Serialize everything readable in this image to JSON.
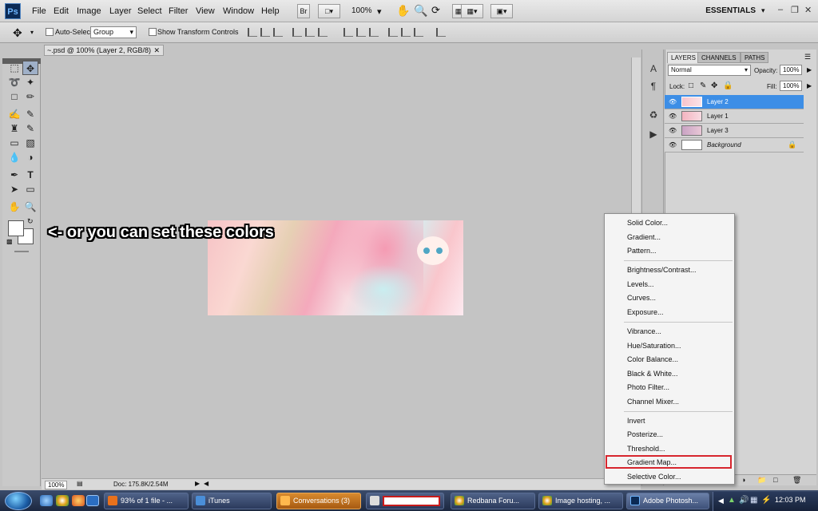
{
  "app": {
    "logo": "Ps",
    "menus": [
      "File",
      "Edit",
      "Image",
      "Layer",
      "Select",
      "Filter",
      "View",
      "Window",
      "Help"
    ],
    "bridge_btn": "Br",
    "zoom": "100%",
    "workspace": "ESSENTIALS"
  },
  "options": {
    "auto_select_label": "Auto-Select:",
    "auto_select_value": "Group",
    "transform_label": "Show Transform Controls"
  },
  "document": {
    "tab_title": "~.psd @ 100% (Layer 2, RGB/8)",
    "annotation": "<- or you can set these colors",
    "status_zoom": "100%",
    "status_doc": "Doc: 175.8K/2.54M"
  },
  "layers_panel": {
    "tabs": [
      "LAYERS",
      "CHANNELS",
      "PATHS"
    ],
    "blend_mode": "Normal",
    "opacity_label": "Opacity:",
    "opacity_value": "100%",
    "lock_label": "Lock:",
    "fill_label": "Fill:",
    "fill_value": "100%",
    "layers": [
      {
        "name": "Layer 2",
        "selected": true
      },
      {
        "name": "Layer 1",
        "selected": false
      },
      {
        "name": "Layer 3",
        "selected": false
      },
      {
        "name": "Background",
        "selected": false
      }
    ]
  },
  "adjustment_menu": {
    "items": [
      "Solid Color...",
      "Gradient...",
      "Pattern...",
      "Brightness/Contrast...",
      "Levels...",
      "Curves...",
      "Exposure...",
      "Vibrance...",
      "Hue/Saturation...",
      "Color Balance...",
      "Black & White...",
      "Photo Filter...",
      "Channel Mixer...",
      "Invert",
      "Posterize...",
      "Threshold...",
      "Gradient Map...",
      "Selective Color..."
    ],
    "highlighted": "Gradient Map..."
  },
  "taskbar": {
    "buttons": [
      "93% of 1 file - ...",
      "iTunes",
      "Conversations (3)",
      "",
      "Redbana Foru...",
      "Image hosting, ...",
      "Adobe Photosh..."
    ],
    "clock": "12:03 PM"
  },
  "colors": {
    "accent_selected_layer": "#3d8ee6",
    "highlight_box": "#d7262e"
  }
}
